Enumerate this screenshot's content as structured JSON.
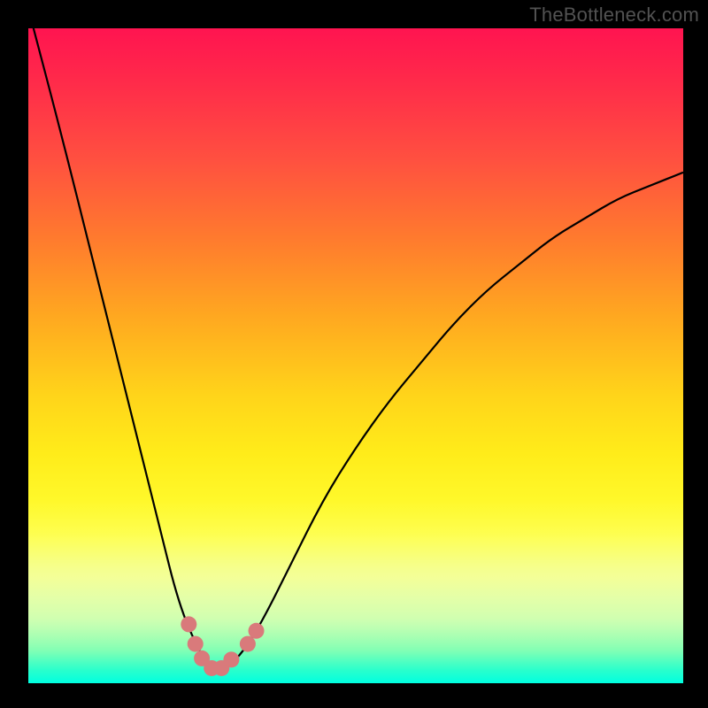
{
  "watermark_text": "TheBottleneck.com",
  "chart_data": {
    "type": "line",
    "title": "",
    "xlabel": "",
    "ylabel": "",
    "xlim": [
      0,
      100
    ],
    "ylim": [
      0,
      100
    ],
    "grid": false,
    "legend": false,
    "series": [
      {
        "name": "bottleneck-curve",
        "x": [
          0,
          5,
          10,
          15,
          20,
          23,
          26,
          28,
          30,
          33,
          36,
          40,
          45,
          50,
          55,
          60,
          65,
          70,
          75,
          80,
          85,
          90,
          95,
          100
        ],
        "y": [
          103,
          84,
          64,
          44,
          24,
          12,
          5,
          2,
          2,
          5,
          10,
          18,
          28,
          36,
          43,
          49,
          55,
          60,
          64,
          68,
          71,
          74,
          76,
          78
        ]
      }
    ],
    "markers": [
      {
        "x": 24.5,
        "y": 9.0
      },
      {
        "x": 25.5,
        "y": 6.0
      },
      {
        "x": 26.5,
        "y": 3.8
      },
      {
        "x": 28.0,
        "y": 2.3
      },
      {
        "x": 29.5,
        "y": 2.3
      },
      {
        "x": 31.0,
        "y": 3.6
      },
      {
        "x": 33.5,
        "y": 6.0
      },
      {
        "x": 34.8,
        "y": 8.0
      }
    ],
    "marker_color": "#d97a7b",
    "curve_color": "#000000",
    "minimum_x": 29
  }
}
